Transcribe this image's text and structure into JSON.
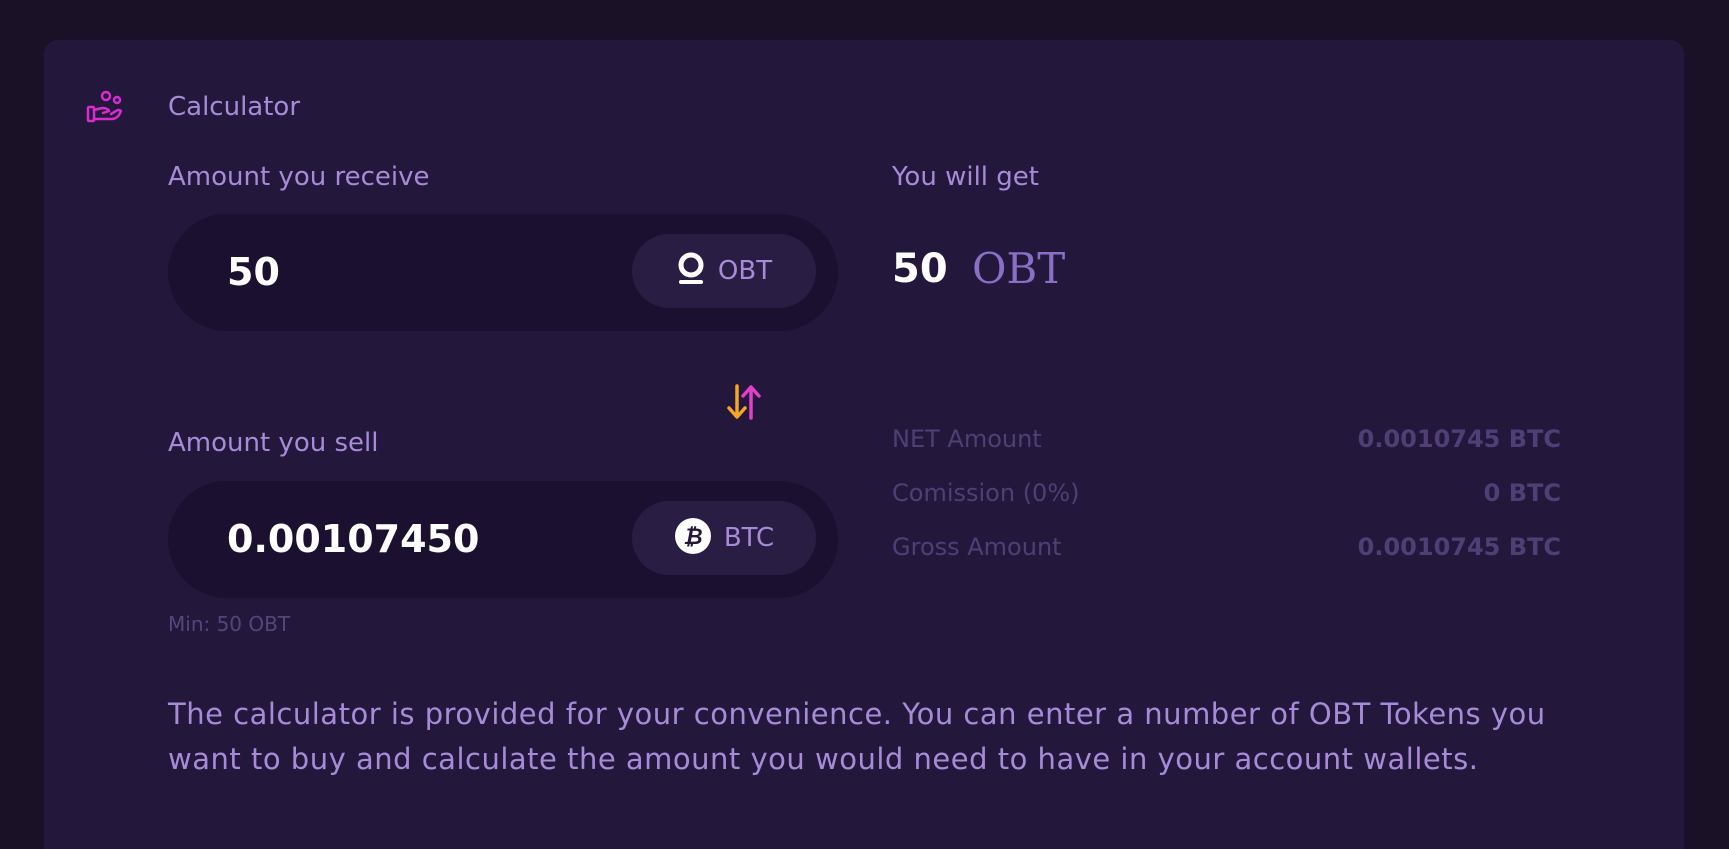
{
  "calculator": {
    "title": "Calculator",
    "icon": "hand-coins-icon"
  },
  "receive": {
    "label": "Amount you receive",
    "value": "50",
    "currency": "OBT",
    "currency_icon": "obt-token-icon"
  },
  "sell": {
    "label": "Amount you sell",
    "value": "0.00107450",
    "currency": "BTC",
    "currency_icon": "bitcoin-icon",
    "min_note": "Min: 50 OBT"
  },
  "swap_icon": "swap-arrows-icon",
  "result": {
    "label": "You will get",
    "value": "50",
    "unit": "OBT"
  },
  "breakdown": [
    {
      "label": "NET Amount",
      "value": "0.0010745 BTC"
    },
    {
      "label": "Comission (0%)",
      "value": "0 BTC"
    },
    {
      "label": "Gross Amount",
      "value": "0.0010745 BTC"
    }
  ],
  "description": "The calculator is provided for your convenience. You can enter a number of OBT Tokens you want to buy and calculate the amount you would need to have in your account wallets.",
  "colors": {
    "background": "#1a1126",
    "card": "#23183c",
    "field": "#1b1030",
    "accent_text": "#a78bd8",
    "muted_text": "#4f3f75",
    "icon_magenta": "#d92bd0",
    "swap_orange": "#f5a623",
    "swap_pink": "#e040c8"
  }
}
